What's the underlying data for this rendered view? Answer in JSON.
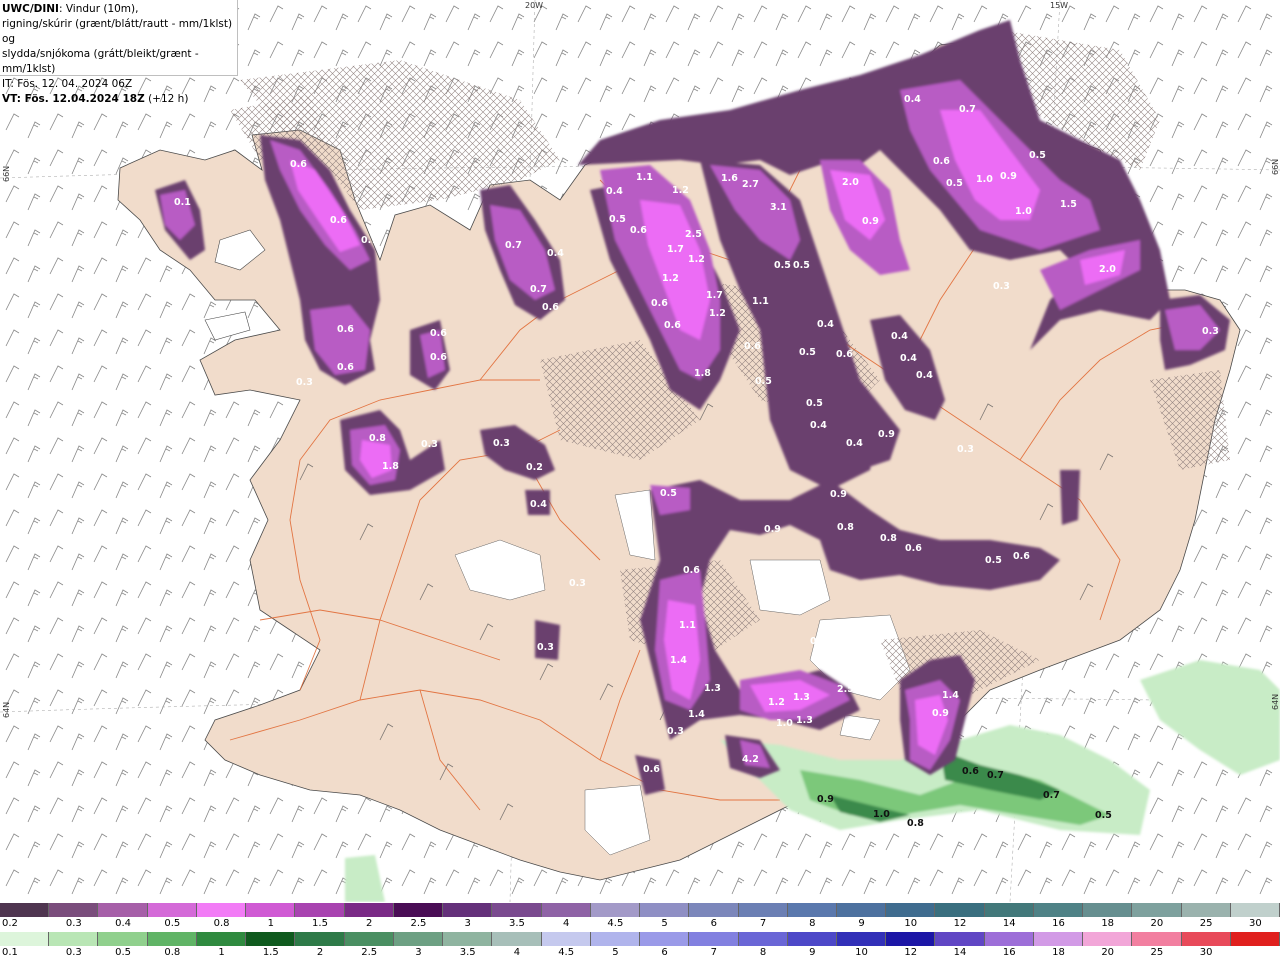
{
  "title": {
    "model": "UWC/DINI",
    "line1_rest": ": Vindur (10m),",
    "line2": "rigning/skúrir (grænt/blátt/rautt - mm/1klst) og",
    "line3": "slydda/snjókoma (grátt/bleikt/grænt - mm/1klst)",
    "issue_time": "IT: Fös. 12. 04. 2024 06Z",
    "valid_prefix": "VT: Fös. 12.04.2024 18Z",
    "valid_suffix": " (+12 h)"
  },
  "graticule_labels": {
    "lon_20w": "20W",
    "lon_15w": "15W",
    "lat_66n_left": "66N",
    "lat_66n_right": "66N",
    "lat_64n_left": "64N",
    "lat_64n_right": "64N"
  },
  "colors": {
    "land": "#f1dccb",
    "sea": "#ffffff",
    "roads": "#e0642c",
    "barbs": "#555555",
    "snow_dark": "#6a3f6e",
    "snow_mid": "#a24fb0",
    "snow_light": "#e25ff0",
    "rain_light": "#c8ecc6",
    "rain_mid": "#7cc87a",
    "rain_dark": "#3b8a4b"
  },
  "precip_values": {
    "snow": [
      "0.1",
      "0.6",
      "0.6",
      "0.7",
      "0.6",
      "0.6",
      "0.6",
      "0.6",
      "0.3",
      "0.8",
      "1.8",
      "0.3",
      "0.3",
      "0.2",
      "0.4",
      "0.7",
      "0.4",
      "0.7",
      "0.6",
      "0.4",
      "0.5",
      "0.6",
      "1.1",
      "1.2",
      "2.5",
      "1.7",
      "1.2",
      "1.2",
      "1.7",
      "1.2",
      "0.6",
      "0.6",
      "1.8",
      "1.6",
      "2.7",
      "3.1",
      "0.5",
      "0.5",
      "1.1",
      "2.0",
      "0.9",
      "0.4",
      "0.7",
      "0.5",
      "1.0",
      "0.9",
      "0.6",
      "1.0",
      "1.5",
      "0.5",
      "0.3",
      "2.0",
      "0.4",
      "0.4",
      "0.4",
      "0.6",
      "0.5",
      "0.5",
      "0.6",
      "0.5",
      "0.4",
      "0.4",
      "0.9",
      "0.4",
      "0.5",
      "0.3",
      "0.9",
      "0.8",
      "0.9",
      "0.8",
      "0.6",
      "0.5",
      "0.6",
      "0.6",
      "1.1",
      "1.4",
      "1.3",
      "1.4",
      "0.3",
      "1.2",
      "1.0",
      "1.3",
      "1.3",
      "2.5",
      "0.3",
      "1.4",
      "0.9",
      "0.3",
      "0.3",
      "4.2",
      "0.6",
      "0.3"
    ],
    "rain": [
      "0.6",
      "0.7",
      "0.7",
      "0.5",
      "0.9",
      "1.0",
      "0.8"
    ]
  },
  "legend_snow": {
    "labels": [
      "0.2",
      "0.3",
      "0.4",
      "0.5",
      "0.8",
      "1",
      "1.5",
      "2",
      "2.5",
      "3",
      "3.5",
      "4",
      "4.5",
      "5",
      "6",
      "7",
      "8",
      "9",
      "10",
      "12",
      "14",
      "16",
      "18",
      "20",
      "25",
      "30"
    ],
    "colors": [
      "#4f3550",
      "#7a4d7c",
      "#a65fa8",
      "#d46ad8",
      "#f27cf6",
      "#d05ad4",
      "#a843b0",
      "#7a2a86",
      "#4a0d55",
      "#64307a",
      "#7a4a8f",
      "#8f63a6",
      "#a39ac8",
      "#8f8fc4",
      "#7c87bb",
      "#6b7fb4",
      "#5a78ad",
      "#4d719f",
      "#3f6c8f",
      "#3a6f7f",
      "#42787a",
      "#4f8286",
      "#668f90",
      "#7ea19e",
      "#9ab2ad",
      "#c0d0cc"
    ]
  },
  "legend_rain": {
    "labels": [
      "0.1",
      "0.3",
      "0.5",
      "0.8",
      "1",
      "1.5",
      "2",
      "2.5",
      "3",
      "3.5",
      "4",
      "4.5",
      "5",
      "6",
      "7",
      "8",
      "9",
      "10",
      "12",
      "14",
      "16",
      "18",
      "20",
      "25",
      "30"
    ],
    "colors": [
      "#ddf5db",
      "#b9e6b5",
      "#90d08d",
      "#60b466",
      "#2f8a3f",
      "#0f5a1e",
      "#2e7a48",
      "#4a8f62",
      "#6da083",
      "#8fb4a0",
      "#a7bfb9",
      "#c5c9ee",
      "#b0b4ec",
      "#9a9ae8",
      "#8280e0",
      "#6a66d6",
      "#4d48c8",
      "#3230b8",
      "#1c16a6",
      "#6046c4",
      "#9d6ed8",
      "#d29ae6",
      "#f2a6d8",
      "#f27fa0",
      "#e84a5a",
      "#e0201e"
    ]
  }
}
